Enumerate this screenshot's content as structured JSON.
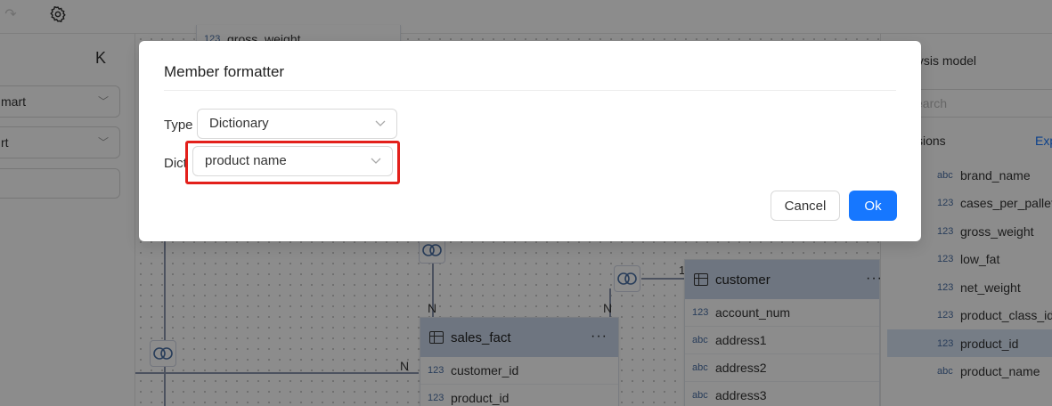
{
  "colors": {
    "primary": "#1677ff",
    "highlight": "#e3201b",
    "table_header": "#c9d6ea",
    "selected_row": "#d7e3f5"
  },
  "left_panel": {
    "select1": "mart",
    "select2": "rt"
  },
  "canvas": {
    "partial_field": "gross_weight",
    "partial_field_type": "123",
    "labels": {
      "n1": "N",
      "n2": "N",
      "n3": "N",
      "one": "1"
    },
    "sales_fact": {
      "title": "sales_fact",
      "more": "···",
      "rows": [
        {
          "type": "123",
          "name": "customer_id"
        },
        {
          "type": "123",
          "name": "product_id"
        }
      ]
    },
    "customer": {
      "title": "customer",
      "more": "···",
      "rows": [
        {
          "type": "123",
          "name": "account_num"
        },
        {
          "type": "abc",
          "name": "address1"
        },
        {
          "type": "abc",
          "name": "address2"
        },
        {
          "type": "abc",
          "name": "address3"
        }
      ]
    }
  },
  "right_panel": {
    "title": "alysis model",
    "search_placeholder": "earch",
    "dimensions_label": "sions",
    "expand_label": "Exp",
    "items": [
      {
        "type": "abc",
        "name": "brand_name"
      },
      {
        "type": "123",
        "name": "cases_per_pallet"
      },
      {
        "type": "123",
        "name": "gross_weight"
      },
      {
        "type": "123",
        "name": "low_fat"
      },
      {
        "type": "123",
        "name": "net_weight"
      },
      {
        "type": "123",
        "name": "product_class_id"
      },
      {
        "type": "123",
        "name": "product_id"
      },
      {
        "type": "abc",
        "name": "product_name"
      }
    ]
  },
  "modal": {
    "title": "Member formatter",
    "type_label": "Type",
    "type_value": "Dictionary",
    "dict_label": "Dict",
    "dict_value": "product name",
    "cancel_label": "Cancel",
    "ok_label": "Ok"
  }
}
